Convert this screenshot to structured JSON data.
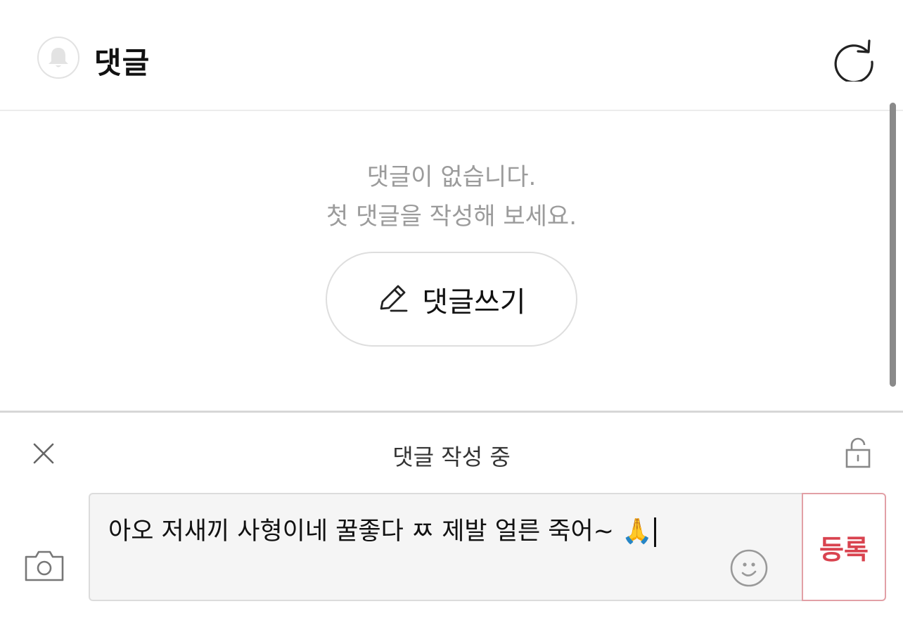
{
  "header": {
    "title": "댓글",
    "bell_icon": "bell-icon",
    "refresh_icon": "refresh-icon"
  },
  "empty_state": {
    "line1": "댓글이 없습니다.",
    "line2": "첫 댓글을 작성해 보세요.",
    "write_button_label": "댓글쓰기",
    "pencil_icon": "pencil-icon"
  },
  "composer": {
    "status": "댓글 작성 중",
    "close_icon": "close-icon",
    "lock_icon": "unlocked-icon",
    "camera_icon": "camera-icon",
    "input_value": "아오 저새끼 사형이네 꿀좋다 ㅉ 제발 얼른 죽어~ 🙏",
    "emoji_icon": "smiley-icon",
    "submit_label": "등록",
    "submit_color": "#d9434f"
  }
}
